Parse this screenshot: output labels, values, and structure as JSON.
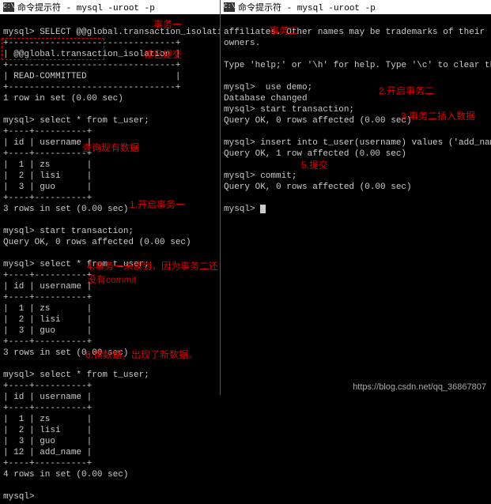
{
  "titlebar": {
    "left": "命令提示符 - mysql  -uroot -p",
    "right": "命令提示符 - mysql  -uroot -p"
  },
  "left": {
    "l1": "mysql> SELECT @@global.transaction_isolation;",
    "l2": "+--------------------------------+",
    "l3": "| @@global.transaction_isolation |",
    "l4": "+--------------------------------+",
    "l5": "| READ-COMMITTED                 |",
    "l6": "+--------------------------------+",
    "l7": "1 row in set (0.00 sec)",
    "l8": "",
    "l9": "mysql> select * from t_user;",
    "l10": "+----+----------+",
    "l11": "| id | username |",
    "l12": "+----+----------+",
    "l13": "|  1 | zs       |",
    "l14": "|  2 | lisi     |",
    "l15": "|  3 | guo      |",
    "l16": "+----+----------+",
    "l17": "3 rows in set (0.00 sec)",
    "l18": "",
    "l19": "mysql> start transaction;",
    "l20": "Query OK, 0 rows affected (0.00 sec)",
    "l21": "",
    "l22": "mysql> select * from t_user;",
    "l23": "+----+----------+",
    "l24": "| id | username |",
    "l25": "+----+----------+",
    "l26": "|  1 | zs       |",
    "l27": "|  2 | lisi     |",
    "l28": "|  3 | guo      |",
    "l29": "+----+----------+",
    "l30": "3 rows in set (0.00 sec)",
    "l31": "",
    "l32": "mysql> select * from t_user;",
    "l33": "+----+----------+",
    "l34": "| id | username |",
    "l35": "+----+----------+",
    "l36": "|  1 | zs       |",
    "l37": "|  2 | lisi     |",
    "l38": "|  3 | guo      |",
    "l39": "| 12 | add_name |",
    "l40": "+----+----------+",
    "l41": "4 rows in set (0.00 sec)",
    "l42": "",
    "l43": "mysql> "
  },
  "right": {
    "l1": "affiliates. Other names may be trademarks of their respective",
    "l2": "owners.",
    "l3": "",
    "l4": "Type 'help;' or '\\h' for help. Type '\\c' to clear the current",
    "l5": "",
    "l6": "mysql>  use demo;",
    "l7": "Database changed",
    "l8": "mysql> start transaction;",
    "l9": "Query OK, 0 rows affected (0.00 sec)",
    "l10": "",
    "l11": "mysql> insert into t_user(username) values ('add_name');",
    "l12": "Query OK, 1 row affected (0.00 sec)",
    "l13": "",
    "l14": "mysql> commit;",
    "l15": "Query OK, 0 rows affected (0.00 sec)",
    "l16": "",
    "l17": "mysql> "
  },
  "annot": {
    "a1": "事务一",
    "a2": "事务二",
    "a3": "读已提交",
    "a4": "查询现有数据",
    "a5": "1.开启事务一",
    "a6": "2.开启事务二",
    "a7": "3.事务二插入数据",
    "a8": "4.事务一未读到，因为事务二还没有commit",
    "a9": "5.提交",
    "a10": "6.读数据，出现了新数据。"
  },
  "watermark": "https://blog.csdn.net/qq_36867807"
}
